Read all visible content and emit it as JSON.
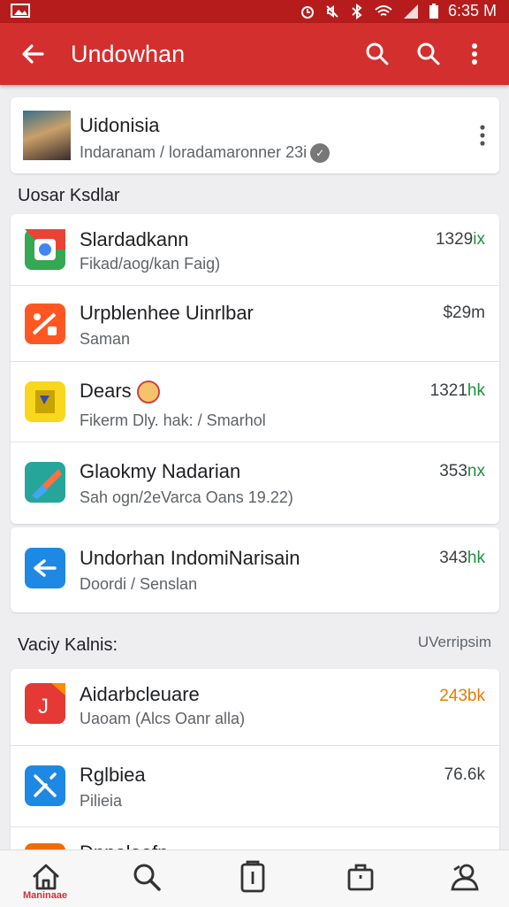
{
  "status_bar": {
    "time": "6:35 M"
  },
  "app_bar": {
    "title": "Undowhan"
  },
  "profile": {
    "name": "Uidonisia",
    "subtitle": "Indaranam / loradamaronner 23i"
  },
  "section1": {
    "title": "Uosar Ksdlar",
    "items": [
      {
        "name": "Slardadkann",
        "sub": "Fikad/aog/kan Faig)",
        "value": "1329",
        "suffix": "ix",
        "icon_color": "#34a853"
      },
      {
        "name": "Urpblenhee Uinrlbar",
        "sub": "Saman",
        "value": "$29m",
        "suffix": "",
        "icon_color": "#ff5722"
      },
      {
        "name": "Dears",
        "sub": "Fikerm Dly. hak: / Smarhol",
        "value": "1321",
        "suffix": "hk",
        "icon_color": "#f9d71c"
      },
      {
        "name": "Glaokmy Nadarian",
        "sub": "Sah  ogn/2eVarca Oans 19.22)",
        "value": "353",
        "suffix": "nx",
        "icon_color": "#26a69a"
      }
    ]
  },
  "single_item": {
    "name": "Undorhan IndomiNarisain",
    "sub": "Doordi / Senslan",
    "value": "343",
    "suffix": "hk",
    "icon_color": "#1e88e5"
  },
  "section2": {
    "title": "Vaciy Kalnis:",
    "right": "UVerripsim",
    "items": [
      {
        "name": "Aidarbcleuare",
        "sub": "Uaoam (Alcs Oanr alla)",
        "value": "243",
        "suffix": "bk",
        "icon_color": "#e53935"
      },
      {
        "name": "Rglbiea",
        "sub": "Pilieia",
        "value": "76.6k",
        "suffix": "",
        "icon_color": "#1e88e5"
      },
      {
        "name": "Dnnalaefn",
        "sub": "",
        "value": "",
        "suffix": "",
        "icon_color": "#ef6c00"
      }
    ]
  },
  "bottom_nav": {
    "home_label": "Maninaae"
  }
}
